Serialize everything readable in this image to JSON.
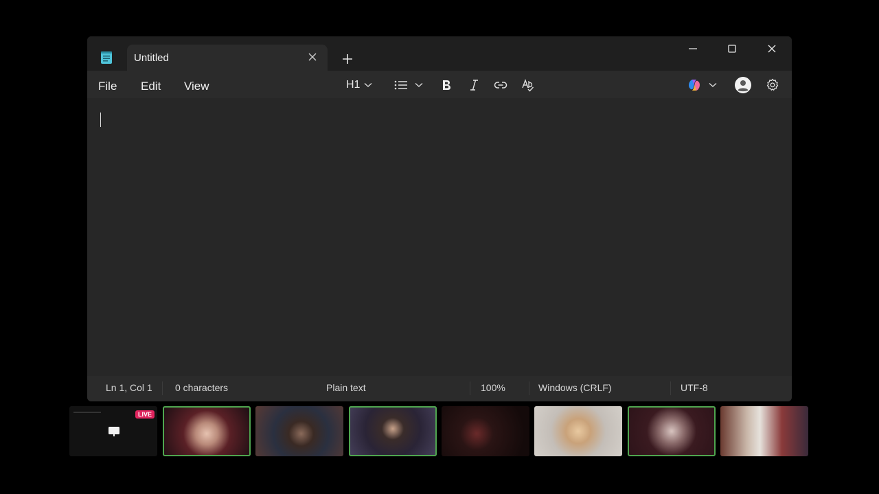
{
  "window": {
    "tab_title": "Untitled"
  },
  "menu": {
    "file": "File",
    "edit": "Edit",
    "view": "View"
  },
  "toolbar": {
    "heading_label": "H1"
  },
  "status": {
    "position": "Ln 1, Col 1",
    "characters": "0 characters",
    "format": "Plain text",
    "zoom": "100%",
    "line_endings": "Windows (CRLF)",
    "encoding": "UTF-8"
  },
  "participants_strip": {
    "live_badge": "LIVE",
    "tiles": [
      {
        "kind": "screen-share",
        "active": false
      },
      {
        "kind": "camera",
        "active": true
      },
      {
        "kind": "camera",
        "active": false
      },
      {
        "kind": "camera",
        "active": true
      },
      {
        "kind": "camera",
        "active": false
      },
      {
        "kind": "camera",
        "active": false
      },
      {
        "kind": "camera",
        "active": true
      },
      {
        "kind": "camera",
        "active": false
      }
    ]
  },
  "colors": {
    "active_tile_border": "#4fa64f",
    "live_badge": "#e0245e",
    "app_icon": "#4fc3d9"
  }
}
